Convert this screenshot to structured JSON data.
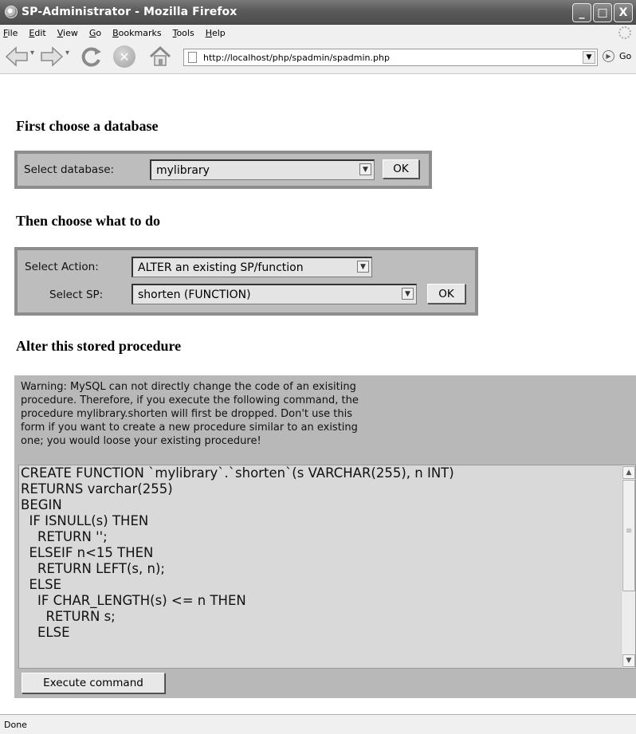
{
  "window": {
    "title": "SP-Administrator - Mozilla Firefox",
    "controls": [
      "_",
      "□",
      "X"
    ]
  },
  "menu": {
    "items": [
      "File",
      "Edit",
      "View",
      "Go",
      "Bookmarks",
      "Tools",
      "Help"
    ]
  },
  "nav": {
    "url": "http://localhost/php/spadmin/spadmin.php",
    "go_label": "Go"
  },
  "sections": {
    "choose_db": {
      "heading": "First choose a database",
      "label": "Select database:",
      "selected": "mylibrary",
      "button": "OK"
    },
    "choose_action": {
      "heading": "Then choose what to do",
      "action_label": "Select Action:",
      "action_selected": "ALTER  an existing SP/function",
      "sp_label": "Select SP:",
      "sp_selected": "shorten  (FUNCTION)",
      "button": "OK"
    },
    "alter": {
      "heading": "Alter this stored procedure",
      "warning": [
        "Warning: MySQL can not directly change the code of an exisiting",
        "procedure. Therefore, if you execute the following command, the",
        "procedure mylibrary.shorten will first be dropped. Don't use this",
        "form if you want to create a new procedure similar to an existing",
        "one; you would loose your existing procedure!"
      ],
      "code_lines": [
        "CREATE FUNCTION `mylibrary`.`shorten`(s VARCHAR(255), n INT)",
        "RETURNS varchar(255)",
        "BEGIN",
        "  IF ISNULL(s) THEN",
        "    RETURN '';",
        "  ELSEIF n<15 THEN",
        "    RETURN LEFT(s, n);",
        "  ELSE",
        "    IF CHAR_LENGTH(s) <= n THEN",
        "      RETURN s;",
        "    ELSE"
      ],
      "execute_button": "Execute command"
    }
  },
  "status": {
    "text": "Done"
  },
  "icons": {
    "back": "back-arrow-icon",
    "forward": "forward-arrow-icon",
    "reload": "reload-icon",
    "stop": "stop-icon",
    "home": "home-icon",
    "page": "page-icon",
    "go": "go-arrow-icon"
  }
}
